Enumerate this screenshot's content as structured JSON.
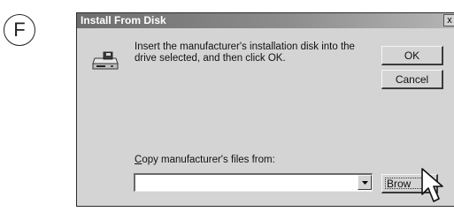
{
  "step_label": "F",
  "dialog": {
    "title": "Install From Disk",
    "close_glyph": "x",
    "icon": "floppy-disk-drive-icon",
    "message": "Insert the manufacturer's installation disk into the drive selected, and then click OK.",
    "ok_label": "OK",
    "cancel_label": "Cancel",
    "copy_label_mnemonic": "C",
    "copy_label_rest": "opy manufacturer's files from:",
    "path_value": "",
    "browse_label": "Brow"
  },
  "cursor_icon": "arrow-pointer-icon"
}
